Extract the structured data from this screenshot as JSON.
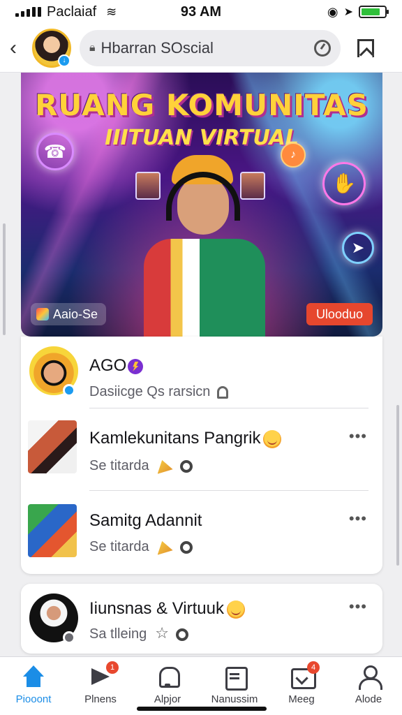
{
  "status_bar": {
    "carrier": "Paclaiaf",
    "time": "93 AM",
    "battery_level": 0.8,
    "wifi_icon": "wifi-icon"
  },
  "header": {
    "search_text": "Hbarran SOscial",
    "back_icon": "chevron-left-icon",
    "refresh_icon": "refresh-icon",
    "bookmark_icon": "bookmark-icon"
  },
  "banner": {
    "title": "RUANG KOMUNITAS",
    "subtitle": "IIITUAN VIRTUAL",
    "chip_left": "Aaio-Se",
    "chip_right": "Ulooduo"
  },
  "rows": [
    {
      "name": "AGO",
      "sub": "Dasiicge Qs rarsicn"
    },
    {
      "name": "Kamlekunitans Pangrik",
      "sub": "Se titarda"
    },
    {
      "name": "Samitg Adannit",
      "sub": "Se titarda"
    },
    {
      "name": "Iiunsnas  & Virtuuk",
      "sub": "Sa tlleing"
    }
  ],
  "nav": [
    {
      "label": "Piooont",
      "icon": "home-icon",
      "active": true
    },
    {
      "label": "Plnens",
      "icon": "play-icon",
      "badge": "1"
    },
    {
      "label": "Alpjor",
      "icon": "bell-icon"
    },
    {
      "label": "Nanussim",
      "icon": "clipboard-icon"
    },
    {
      "label": "Meeg",
      "icon": "message-icon",
      "badge": "4"
    },
    {
      "label": "Alode",
      "icon": "user-icon"
    }
  ],
  "colors": {
    "accent": "#1b8de6",
    "badge": "#e8482e",
    "banner_title": "#ffd23a"
  }
}
